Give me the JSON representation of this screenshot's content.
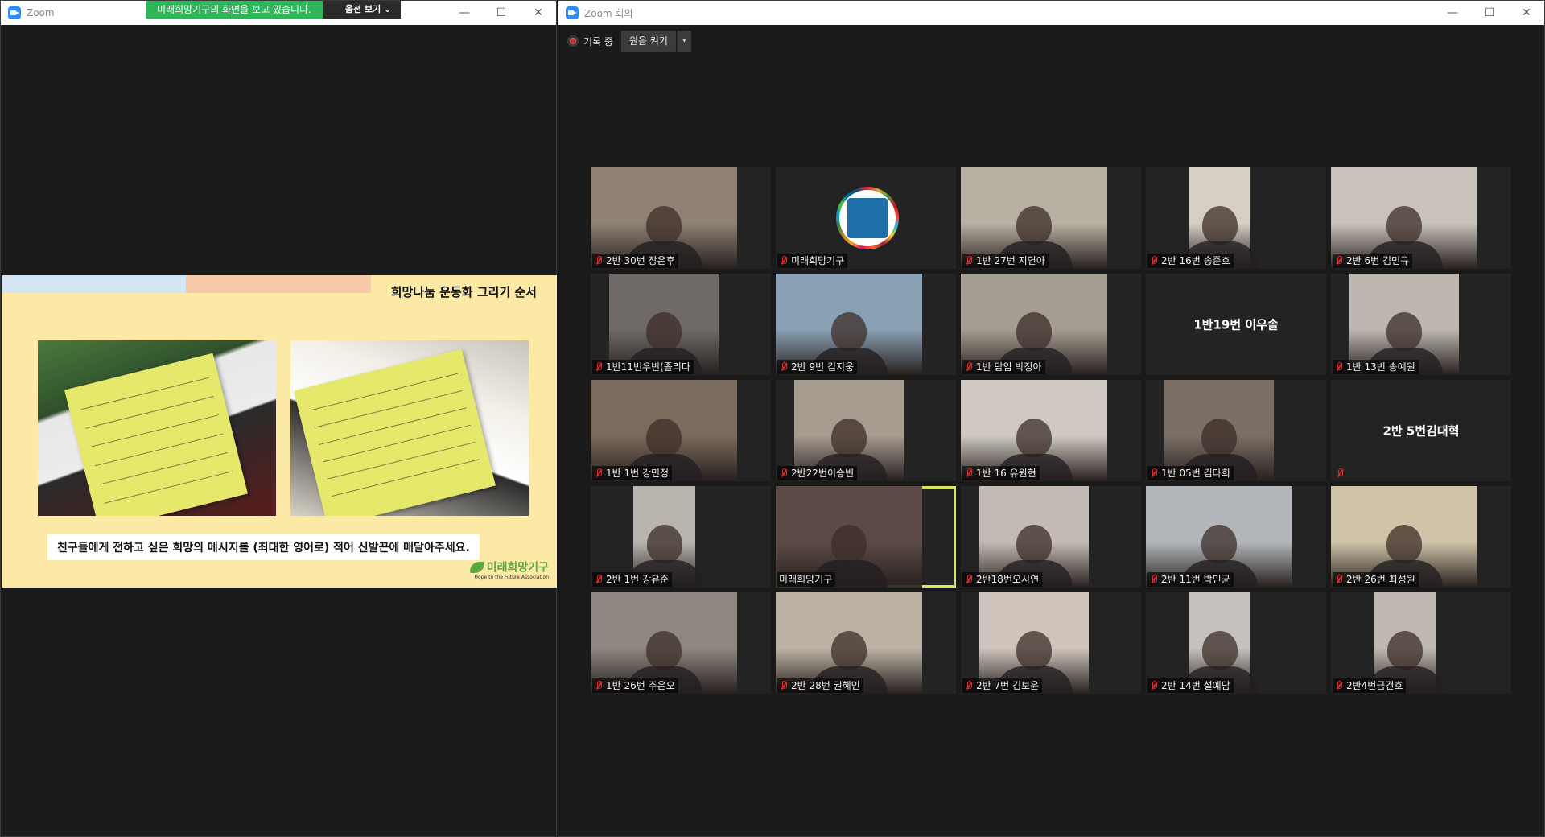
{
  "share_window": {
    "title": "Zoom",
    "banner_text": "미래희망기구의 화면을 보고 있습니다.",
    "view_options_label": "옵션 보기 ⌄",
    "slide": {
      "title": "희망나눔 운동화 그리기 순서",
      "caption": "친구들에게 전하고 싶은 희망의 메시지를 (최대한 영어로) 적어 신발끈에 매달아주세요.",
      "logo_ko": "미래희망기구",
      "logo_en": "Hope to the Future Association"
    }
  },
  "meeting_window": {
    "title": "Zoom 회의",
    "recording_label": "기록 중",
    "view_button_label": "원음 켜기",
    "view_dropdown_glyph": "▾",
    "participants": [
      {
        "name": "2반 30번 장은후",
        "video": true,
        "muted": true,
        "bg": "#8f8275",
        "vw": 182,
        "vx": 0
      },
      {
        "name": "미래희망기구",
        "video": false,
        "logo": true,
        "muted": true
      },
      {
        "name": "1반 27번 지연아",
        "video": true,
        "muted": true,
        "bg": "#b8b0a2",
        "vw": 182,
        "vx": 0
      },
      {
        "name": "2반 16번 송준호",
        "video": true,
        "muted": true,
        "bg": "#d6cfc4",
        "vw": 77,
        "vx": 53
      },
      {
        "name": "2반 6번 김민규",
        "video": true,
        "muted": true,
        "bg": "#c9c2bb",
        "vw": 182,
        "vx": 0
      },
      {
        "name": "1반11번우빈(졸리다",
        "video": true,
        "muted": true,
        "bg": "#6f6a68",
        "vw": 136,
        "vx": 23
      },
      {
        "name": "2반 9번 김지웅",
        "video": true,
        "muted": true,
        "bg": "#8aa0b4",
        "vw": 182,
        "vx": 0
      },
      {
        "name": "1반 담임 박정아",
        "video": true,
        "muted": true,
        "bg": "#a49d92",
        "vw": 182,
        "vx": 0
      },
      {
        "name": "1반19번 이우솔",
        "video": false,
        "muted": false,
        "center": true
      },
      {
        "name": "1반 13번 송예원",
        "video": true,
        "muted": true,
        "bg": "#bdb7b0",
        "vw": 136,
        "vx": 23
      },
      {
        "name": "1반 1번 강민정",
        "video": true,
        "muted": true,
        "bg": "#7b6b5c",
        "vw": 182,
        "vx": 0
      },
      {
        "name": "2반22번이승빈",
        "video": true,
        "muted": true,
        "bg": "#a69c90",
        "vw": 136,
        "vx": 23
      },
      {
        "name": "1반 16 유원현",
        "video": true,
        "muted": true,
        "bg": "#cfc9c2",
        "vw": 182,
        "vx": 0
      },
      {
        "name": "1반 05번 김다희",
        "video": true,
        "muted": true,
        "bg": "#7c6f66",
        "vw": 136,
        "vx": 23
      },
      {
        "name": "2반 5번김대혁",
        "video": false,
        "muted": true,
        "center": true
      },
      {
        "name": "2반 1번 강유준",
        "video": true,
        "muted": true,
        "bg": "#b9b4ad",
        "vw": 77,
        "vx": 53
      },
      {
        "name": "미래희망기구",
        "video": true,
        "muted": false,
        "speaking": true,
        "bg": "#5b4a45",
        "vw": 182,
        "vx": 0
      },
      {
        "name": "2반18번오시연",
        "video": true,
        "muted": true,
        "bg": "#c3bbb3",
        "vw": 136,
        "vx": 23
      },
      {
        "name": "2반 11번 박민균",
        "video": true,
        "muted": true,
        "bg": "#b3b7bb",
        "vw": 182,
        "vx": 0
      },
      {
        "name": "2반 26번 최성원",
        "video": true,
        "muted": true,
        "bg": "#cfc3a8",
        "vw": 182,
        "vx": 0
      },
      {
        "name": "1반 26번 주은오",
        "video": true,
        "muted": true,
        "bg": "#8e8880",
        "vw": 182,
        "vx": 0
      },
      {
        "name": "2반 28번 권혜인",
        "video": true,
        "muted": true,
        "bg": "#bcb2a4",
        "vw": 182,
        "vx": 0
      },
      {
        "name": "2반 7번 김보윤",
        "video": true,
        "muted": true,
        "bg": "#cfc5bd",
        "vw": 136,
        "vx": 23
      },
      {
        "name": "2반 14번 설예담",
        "video": true,
        "muted": true,
        "bg": "#c5c1bf",
        "vw": 77,
        "vx": 53
      },
      {
        "name": "2반4번금건호",
        "video": true,
        "muted": true,
        "bg": "#c0b9b1",
        "vw": 77,
        "vx": 53
      }
    ]
  }
}
